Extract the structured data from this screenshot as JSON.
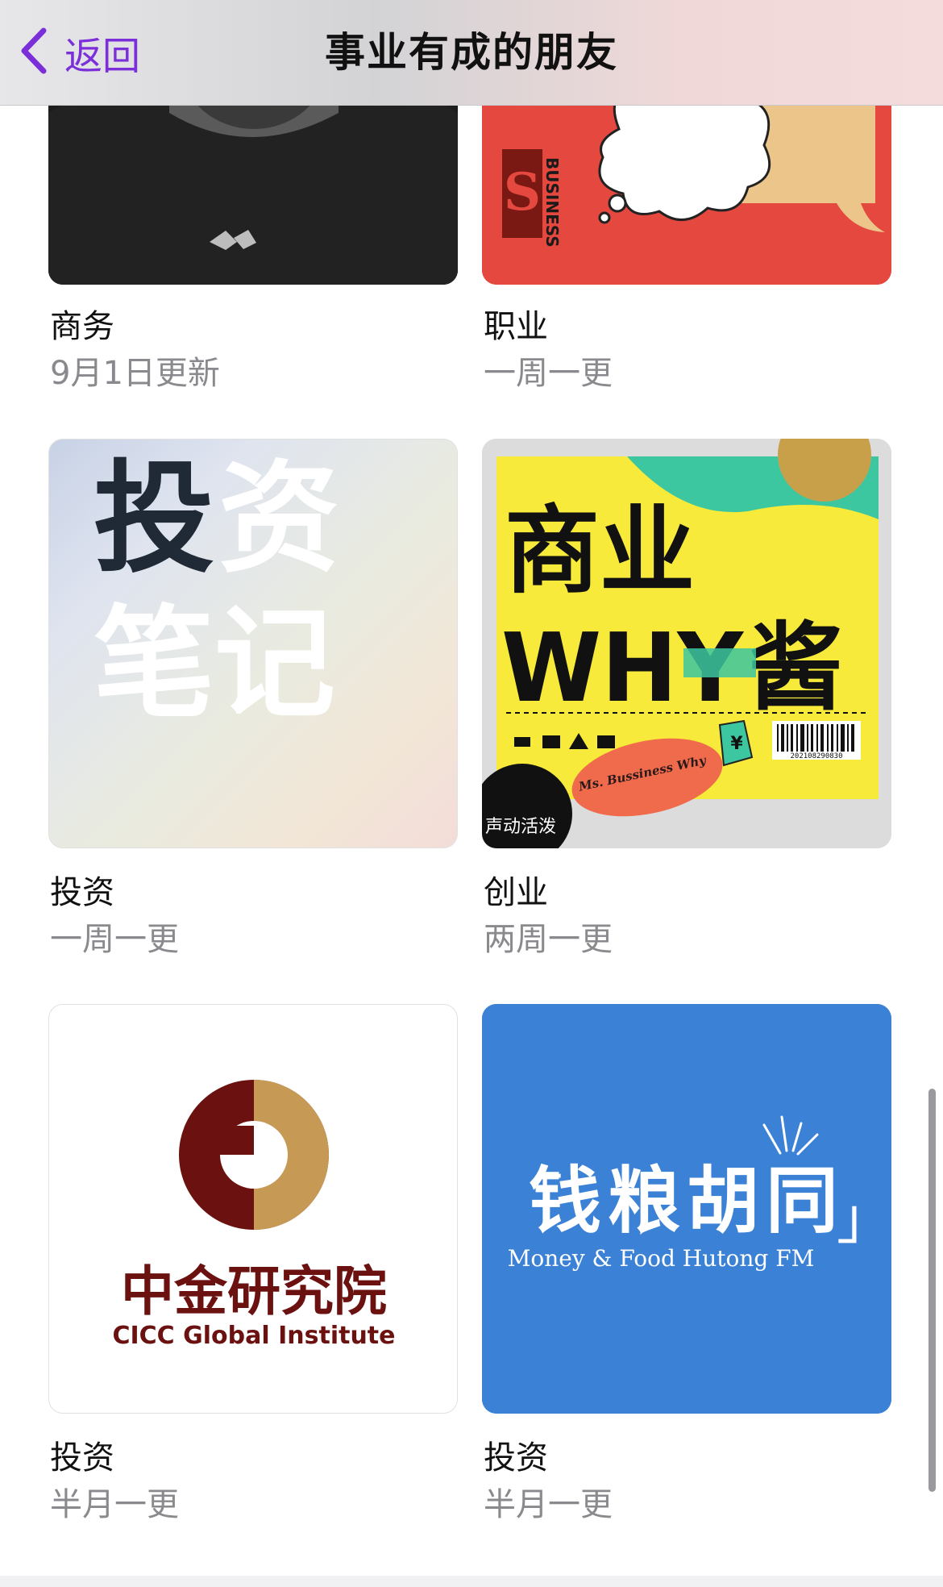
{
  "nav": {
    "back_label": "返回",
    "title": "事业有成的朋友"
  },
  "cards": [
    {
      "title": "商务",
      "subtitle": "9月1日更新"
    },
    {
      "title": "职业",
      "subtitle": "一周一更"
    },
    {
      "title": "投资",
      "subtitle": "一周一更"
    },
    {
      "title": "创业",
      "subtitle": "两周一更"
    },
    {
      "title": "投资",
      "subtitle": "半月一更"
    },
    {
      "title": "投资",
      "subtitle": "半月一更"
    }
  ],
  "artwork": {
    "stanford": {
      "text": "BUSINESS",
      "letter": "S"
    },
    "touzi": {
      "line1_a": "投",
      "line1_b": "资",
      "line2": "笔记"
    },
    "why": {
      "big_line1": "商业",
      "big_line2_a": "WHY",
      "big_line2_b": "酱",
      "sticker": "Ms. Bussiness Why",
      "barcode_number": "202108290830",
      "badge": "声动活泼",
      "yen": "¥"
    },
    "cicc": {
      "cn": "中金研究院",
      "en": "CICC Global Institute"
    },
    "hutong": {
      "cn_left_bracket": "「",
      "cn": "钱粮胡同",
      "cn_right_bracket": "」",
      "en": "Money & Food Hutong FM"
    }
  },
  "colors": {
    "accent": "#7a2fd8",
    "stanford_red": "#e5483f",
    "why_yellow": "#f7ea3a",
    "cicc_maroon": "#6b1210",
    "cicc_gold": "#c69a55",
    "hutong_blue": "#3b82d6"
  }
}
